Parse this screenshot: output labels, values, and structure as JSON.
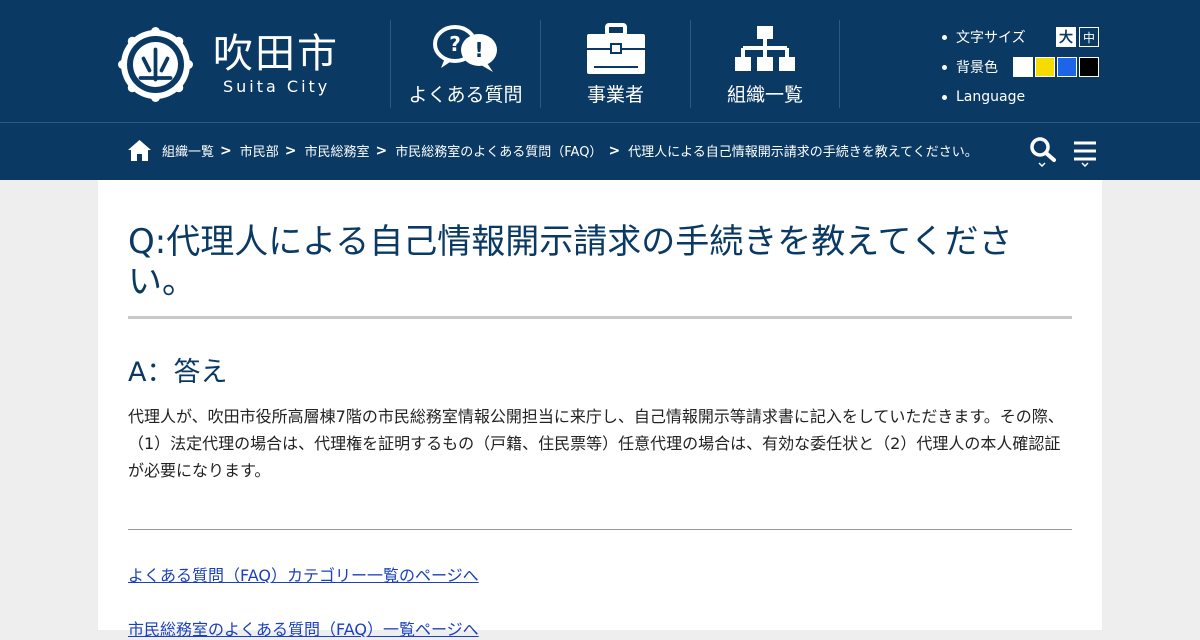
{
  "header": {
    "title": "吹田市",
    "subtitle": "Suita City",
    "nav": [
      {
        "label": "よくある質問"
      },
      {
        "label": "事業者"
      },
      {
        "label": "組織一覧"
      }
    ],
    "tools": {
      "font_size_label": "文字サイズ",
      "font_large": "大",
      "font_mid": "中",
      "bg_label": "背景色",
      "bg_colors": [
        "#ffffff",
        "#f5dc00",
        "#1e64e6",
        "#000000"
      ],
      "language_label": "Language"
    }
  },
  "breadcrumb": {
    "items": [
      "組織一覧",
      "市民部",
      "市民総務室",
      "市民総務室のよくある質問（FAQ）",
      "代理人による自己情報開示請求の手続きを教えてください。"
    ],
    "separator": ">"
  },
  "main": {
    "title": "Q:代理人による自己情報開示請求の手続きを教えてください。",
    "answer_heading": "A：答え",
    "answer_body": "代理人が、吹田市役所高層棟7階の市民総務室情報公開担当に来庁し、自己情報開示等請求書に記入をしていただきます。その際、（1）法定代理の場合は、代理権を証明するもの（戸籍、住民票等）任意代理の場合は、有効な委任状と（2）代理人の本人確認証が必要になります。",
    "links": [
      "よくある質問（FAQ）カテゴリー一覧のページへ",
      "市民総務室のよくある質問（FAQ）一覧ページへ"
    ]
  },
  "colors": {
    "brand": "#0a3a63",
    "link": "#1a3fbf"
  }
}
